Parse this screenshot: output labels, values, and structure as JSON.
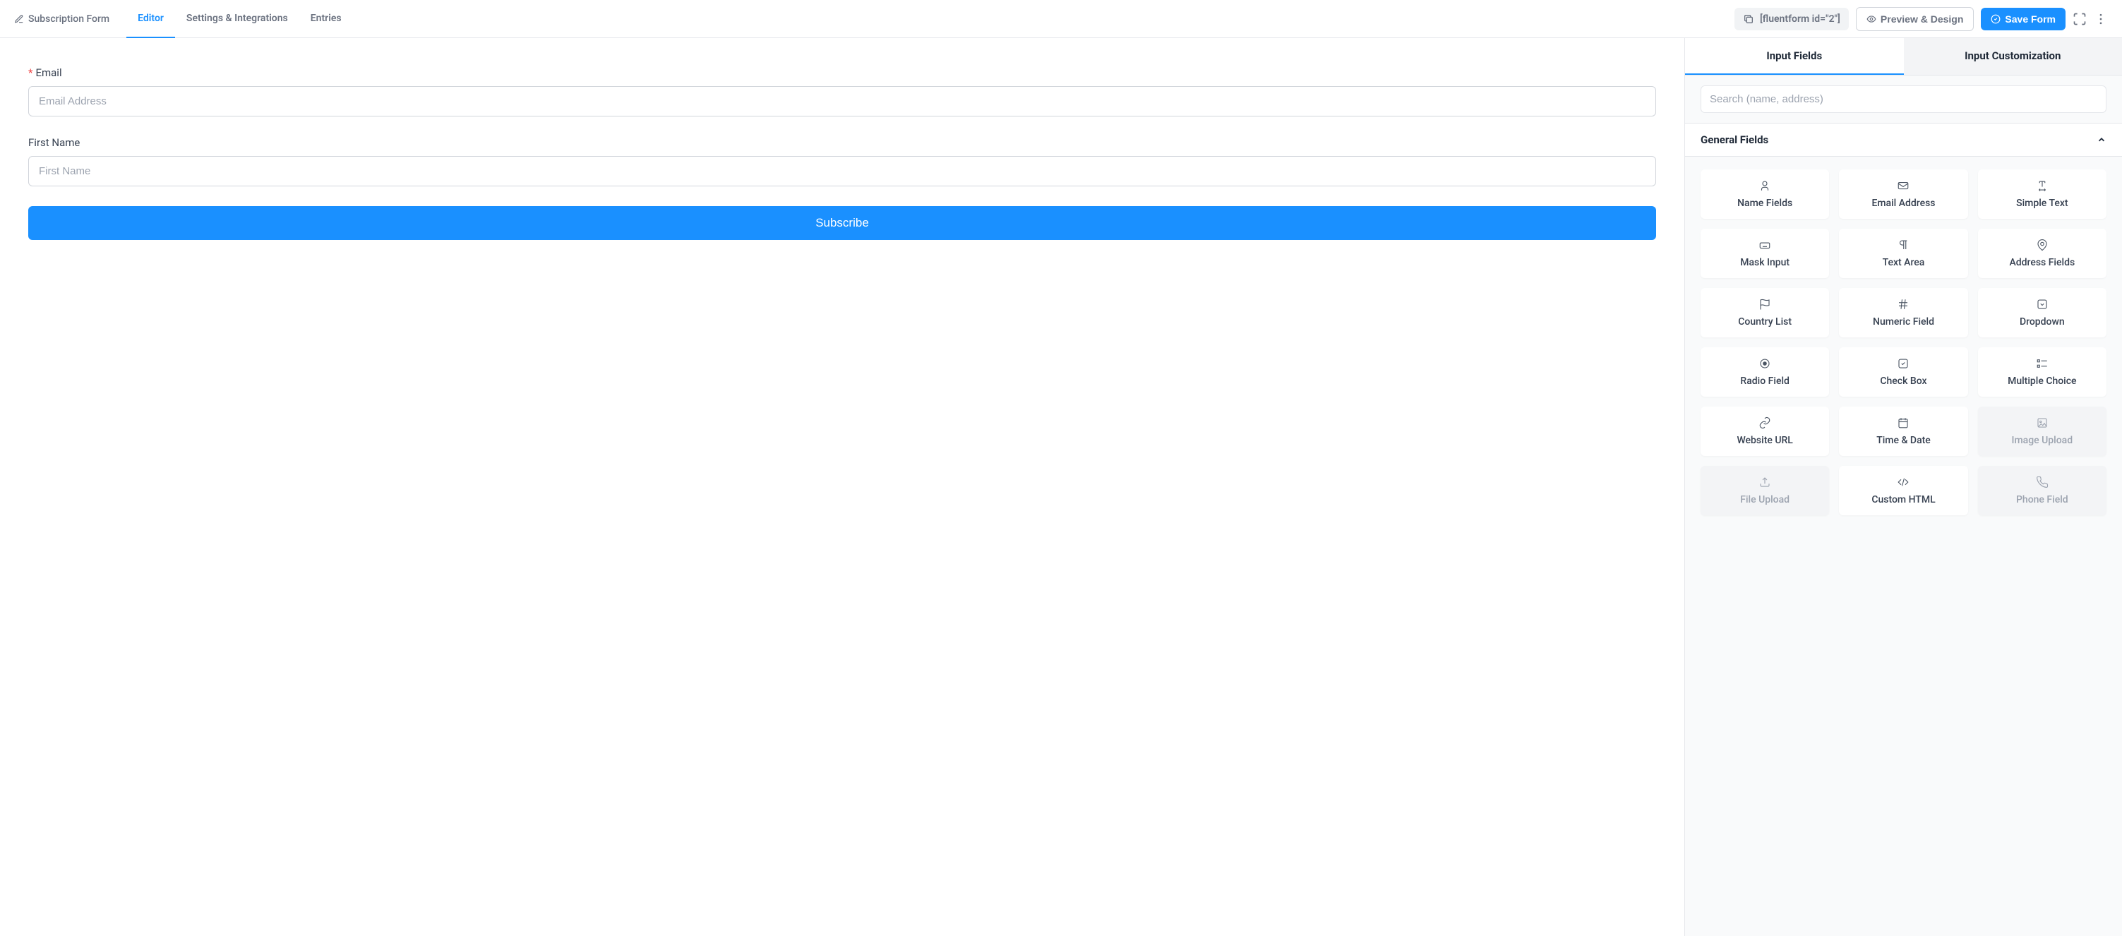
{
  "header": {
    "form_name": "Subscription Form",
    "tabs": {
      "editor": "Editor",
      "settings": "Settings & Integrations",
      "entries": "Entries"
    },
    "shortcode": "[fluentform id=\"2\"]",
    "preview_btn": "Preview & Design",
    "save_btn": "Save Form"
  },
  "canvas": {
    "email": {
      "label": "Email",
      "placeholder": "Email Address"
    },
    "firstname": {
      "label": "First Name",
      "placeholder": "First Name"
    },
    "submit": "Subscribe"
  },
  "sidebar": {
    "tabs": {
      "input_fields": "Input Fields",
      "customization": "Input Customization"
    },
    "search_placeholder": "Search (name, address)",
    "section_general": "General Fields",
    "fields": {
      "name": "Name Fields",
      "email": "Email Address",
      "text": "Simple Text",
      "mask": "Mask Input",
      "textarea": "Text Area",
      "address": "Address Fields",
      "country": "Country List",
      "numeric": "Numeric Field",
      "dropdown": "Dropdown",
      "radio": "Radio Field",
      "checkbox": "Check Box",
      "multi": "Multiple Choice",
      "url": "Website URL",
      "datetime": "Time & Date",
      "imageupload": "Image Upload",
      "fileupload": "File Upload",
      "html": "Custom HTML",
      "phone": "Phone Field"
    }
  }
}
